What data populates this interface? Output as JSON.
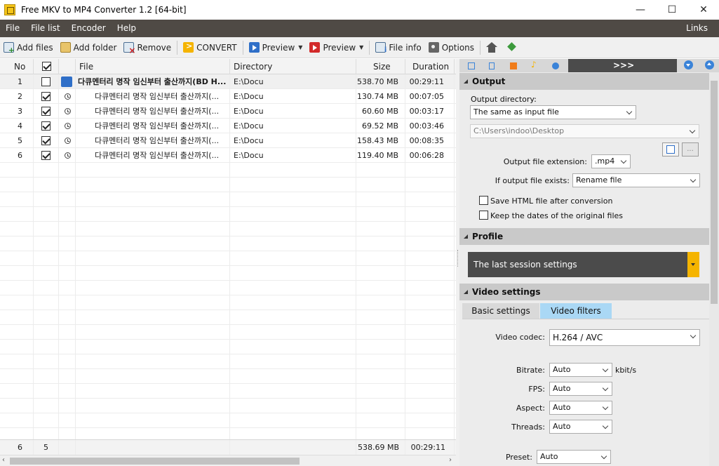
{
  "window": {
    "title": "Free MKV to MP4 Converter 1.2  [64-bit]",
    "minimize": "—",
    "maximize": "☐",
    "close": "✕"
  },
  "menu": {
    "items": [
      "File",
      "File list",
      "Encoder",
      "Help"
    ],
    "links": "Links"
  },
  "toolbar": {
    "add_files": "Add files",
    "add_folder": "Add folder",
    "remove": "Remove",
    "convert": "CONVERT",
    "preview1": "Preview",
    "preview2": "Preview",
    "file_info": "File info",
    "options": "Options"
  },
  "table": {
    "columns": {
      "no": "No",
      "file": "File",
      "directory": "Directory",
      "size": "Size",
      "duration": "Duration"
    },
    "rows": [
      {
        "no": "1",
        "checked": false,
        "file": "다큐멘터리 명작 임신부터 출산까지(BD H...",
        "directory": "E:\\Docu",
        "size": "538.70 MB",
        "duration": "00:29:11",
        "parent": true
      },
      {
        "no": "2",
        "checked": true,
        "file": "다큐멘터리 명작 임신부터 출산까지(...",
        "directory": "E:\\Docu",
        "size": "130.74 MB",
        "duration": "00:07:05",
        "parent": false
      },
      {
        "no": "3",
        "checked": true,
        "file": "다큐멘터리 명작 임신부터 출산까지(...",
        "directory": "E:\\Docu",
        "size": "60.60 MB",
        "duration": "00:03:17",
        "parent": false
      },
      {
        "no": "4",
        "checked": true,
        "file": "다큐멘터리 명작 임신부터 출산까지(...",
        "directory": "E:\\Docu",
        "size": "69.52 MB",
        "duration": "00:03:46",
        "parent": false
      },
      {
        "no": "5",
        "checked": true,
        "file": "다큐멘터리 명작 임신부터 출산까지(...",
        "directory": "E:\\Docu",
        "size": "158.43 MB",
        "duration": "00:08:35",
        "parent": false
      },
      {
        "no": "6",
        "checked": true,
        "file": "다큐멘터리 명작 임신부터 출산까지(...",
        "directory": "E:\\Docu",
        "size": "119.40 MB",
        "duration": "00:06:28",
        "parent": false
      }
    ],
    "footer": {
      "count": "6",
      "checked": "5",
      "size": "538.69 MB",
      "duration": "00:29:11"
    }
  },
  "panel": {
    "more": ">>>",
    "output": {
      "header": "Output",
      "dir_label": "Output directory:",
      "dir_value": "The same as input file",
      "path_value": "C:\\Users\\indoo\\Desktop",
      "ext_label": "Output file extension:",
      "ext_value": ".mp4",
      "exists_label": "If output file exists:",
      "exists_value": "Rename file",
      "save_html": "Save HTML file after conversion",
      "keep_dates": "Keep the dates of the original files",
      "browse_btn": "..."
    },
    "profile": {
      "header": "Profile",
      "value": "The last session settings"
    },
    "video": {
      "header": "Video settings",
      "tab_basic": "Basic settings",
      "tab_filters": "Video filters",
      "codec_label": "Video codec:",
      "codec_value": "H.264 / AVC",
      "bitrate_label": "Bitrate:",
      "bitrate_value": "Auto",
      "bitrate_unit": "kbit/s",
      "fps_label": "FPS:",
      "fps_value": "Auto",
      "aspect_label": "Aspect:",
      "aspect_value": "Auto",
      "threads_label": "Threads:",
      "threads_value": "Auto",
      "preset_label": "Preset:",
      "preset_value": "Auto"
    }
  },
  "colors": {
    "menubar": "#4f4a45",
    "accent_blue": "#3a83d8",
    "accent_orange": "#f5b400",
    "video_filters_tab": "#aad8f5"
  }
}
